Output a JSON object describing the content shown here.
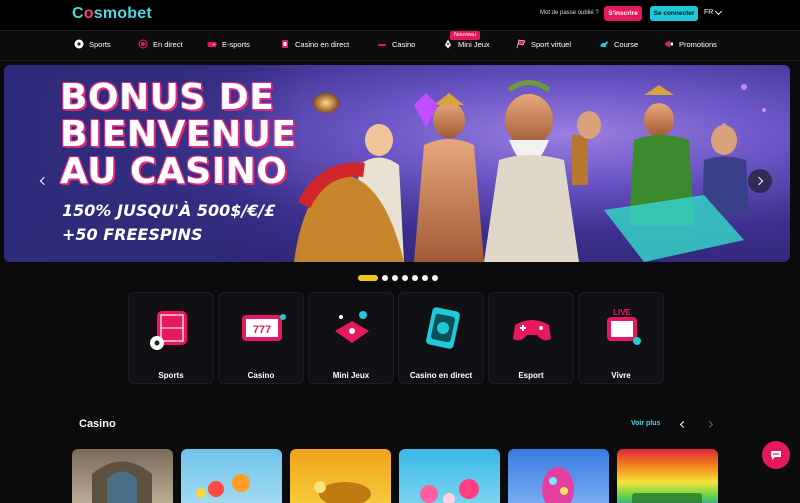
{
  "header": {
    "logo": {
      "prefix": "C",
      "accent": "o",
      "rest": "smobet"
    },
    "forgot_password": "Mot de passe oublié ?",
    "signup_label": "S'inscrire",
    "login_label": "Se connecter",
    "language": "FR"
  },
  "nav": {
    "items": [
      {
        "label": "Sports",
        "icon": "soccer-ball-icon"
      },
      {
        "label": "En direct",
        "icon": "live-icon"
      },
      {
        "label": "E-sports",
        "icon": "gamepad-icon"
      },
      {
        "label": "Casino en direct",
        "icon": "cards-icon"
      },
      {
        "label": "Casino",
        "icon": "dice-icon"
      },
      {
        "label": "Mini Jeux",
        "icon": "rocket-icon"
      },
      {
        "label": "Sport virtuel",
        "icon": "racing-flag-icon"
      },
      {
        "label": "Course",
        "icon": "horse-icon"
      },
      {
        "label": "Promotions",
        "icon": "megaphone-icon"
      }
    ],
    "new_badge": "Nouveau"
  },
  "banner": {
    "title_line1": "BONUS DE",
    "title_line2": "BIENVENUE",
    "title_line3": "AU CASINO",
    "subtitle1": "150% JUSQU'À 500$/€/£",
    "subtitle2": "+50 FREESPINS",
    "slide_count": 7,
    "active_slide": 1
  },
  "categories": [
    {
      "label": "Sports",
      "icon": "sports-icon"
    },
    {
      "label": "Casino",
      "icon": "slot-machine-icon"
    },
    {
      "label": "Mini Jeux",
      "icon": "mini-games-icon"
    },
    {
      "label": "Casino en direct",
      "icon": "live-casino-icon"
    },
    {
      "label": "Esport",
      "icon": "esport-controller-icon"
    },
    {
      "label": "Vivre",
      "icon": "live-tv-icon"
    }
  ],
  "casino_section": {
    "title": "Casino",
    "see_more": "Voir plus"
  },
  "colors": {
    "accent_pink": "#e7195e",
    "accent_cyan": "#1ec9d8",
    "active_dot": "#f2c51b",
    "background": "#0b0b0d"
  }
}
